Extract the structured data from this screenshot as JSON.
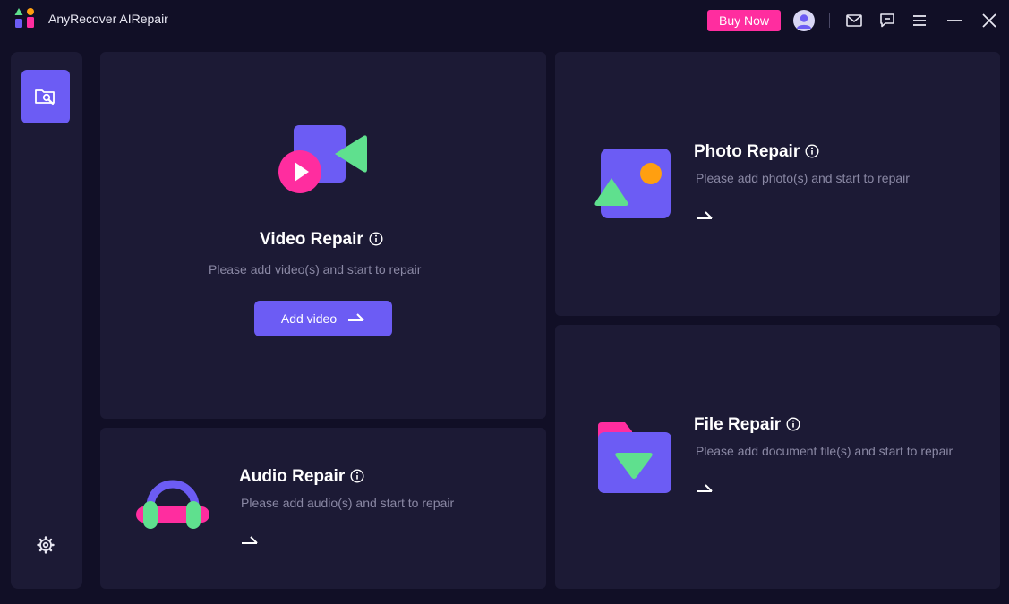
{
  "app": {
    "title": "AnyRecover AIRepair"
  },
  "header": {
    "buy_label": "Buy Now"
  },
  "cards": {
    "video": {
      "title": "Video Repair",
      "desc": "Please add video(s) and start to repair",
      "button": "Add video"
    },
    "photo": {
      "title": "Photo Repair",
      "desc": "Please add photo(s) and start to repair"
    },
    "audio": {
      "title": "Audio Repair",
      "desc": "Please add audio(s) and start to repair"
    },
    "file": {
      "title": "File Repair",
      "desc": "Please add document file(s) and start to repair"
    }
  },
  "colors": {
    "background": "#110f26",
    "panel": "#1c1a35",
    "accent": "#6c5cf4",
    "buy_pink": "#ff2d9f",
    "green": "#5fe08e",
    "orange": "#ff9f10"
  },
  "icons": {
    "titlebar": [
      "avatar-icon",
      "mail-icon",
      "chat-icon",
      "menu-icon",
      "minimize-icon",
      "close-icon"
    ],
    "sidebar": [
      "repair-tool-icon",
      "gear-icon"
    ]
  }
}
